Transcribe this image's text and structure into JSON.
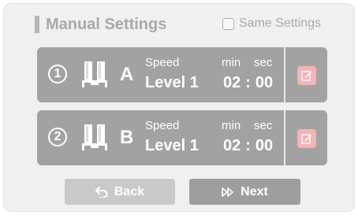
{
  "header": {
    "title": "Manual Settings",
    "same_settings_label": "Same Settings",
    "same_settings_checked": false
  },
  "cards": [
    {
      "index": "1",
      "nozzle": "A",
      "speed_label": "Speed",
      "speed_value": "Level 1",
      "min_label": "min",
      "sec_label": "sec",
      "minutes": "02",
      "separator": ":",
      "seconds": "00",
      "icon": "nozzle-icon"
    },
    {
      "index": "2",
      "nozzle": "B",
      "speed_label": "Speed",
      "speed_value": "Level 1",
      "min_label": "min",
      "sec_label": "sec",
      "minutes": "02",
      "separator": ":",
      "seconds": "00",
      "icon": "nozzle-icon"
    }
  ],
  "footer": {
    "back_label": "Back",
    "next_label": "Next"
  },
  "colors": {
    "card": "#a2a2a2",
    "edit": "#f3b4b8",
    "back_disabled": "#c9c9c9",
    "next": "#9e9e9e"
  }
}
